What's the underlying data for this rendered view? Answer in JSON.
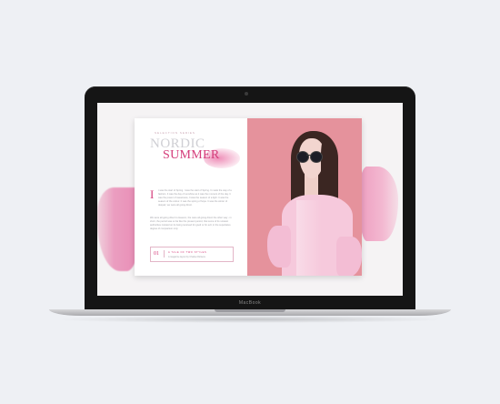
{
  "device": {
    "brand_label": "MacBook"
  },
  "magazine": {
    "eyebrow": "SELECTION SERIES",
    "title_line1": "NORDIC",
    "title_line2": "SUMMER",
    "dropcap": "I",
    "body_paragraph_1": "t was the start of Spring. I was the start of Spring. It made the way of a fashion. It was the day of sunshine as it was the moment of the day. It was the power of sweetness, It was the season of a light. It was the season of the colour. It was the spring of hope. It was the winter of despair, we were all going direct.",
    "body_paragraph_2": "We were all going direct to Heaven, the were all going direct the other way - in short, the period was so far like the present period, that some of its noisiest authorities insisted on its being received for good or for evil, in the superlative degree of comparison only.",
    "callout": {
      "number": "01",
      "title": "A TALE OF TWO STYLES",
      "subtitle": "A magazine layout by Charles Dickens"
    }
  },
  "colors": {
    "accent": "#d43c7a",
    "photo_background": "#e5929c",
    "brush": "#eb9ec0",
    "page_background": "#eef0f4"
  }
}
